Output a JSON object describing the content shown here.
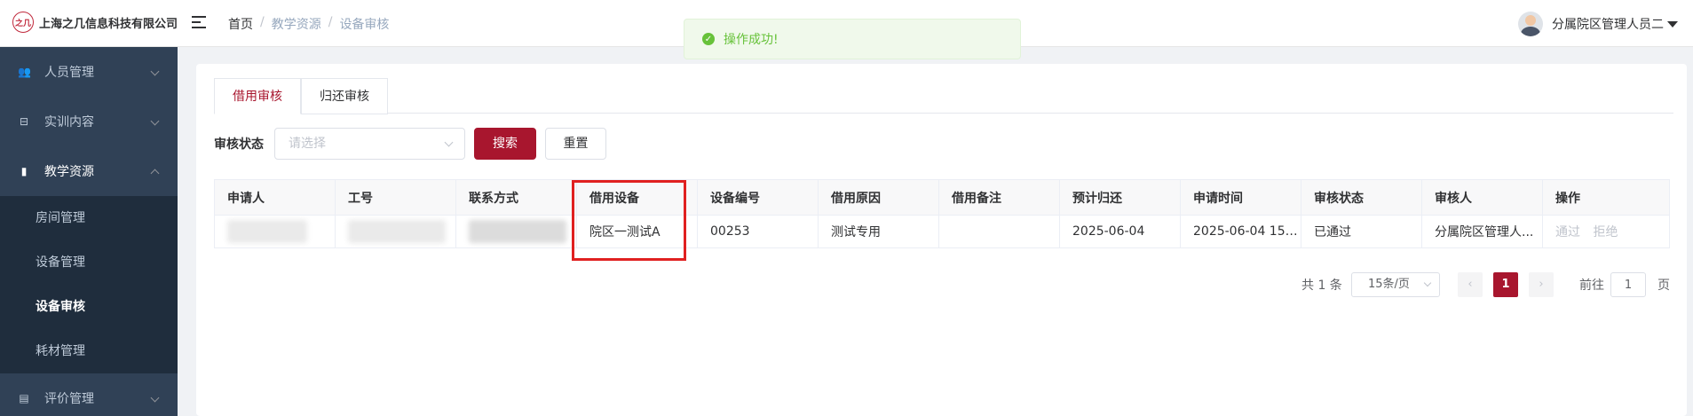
{
  "header": {
    "logo_mark": "之几",
    "company": "上海之几信息科技有限公司",
    "breadcrumb": [
      "首页",
      "教学资源",
      "设备审核"
    ],
    "user_name": "分属院区管理人员二"
  },
  "toast": {
    "message": "操作成功!"
  },
  "sidebar": {
    "menus": [
      {
        "label": "人员管理",
        "icon": "users-icon"
      },
      {
        "label": "实训内容",
        "icon": "training-icon"
      },
      {
        "label": "教学资源",
        "icon": "resource-icon"
      },
      {
        "label": "评价管理",
        "icon": "evaluation-icon"
      }
    ],
    "submenu": [
      "房间管理",
      "设备管理",
      "设备审核",
      "耗材管理"
    ]
  },
  "tabs": [
    "借用审核",
    "归还审核"
  ],
  "filter": {
    "label": "审核状态",
    "placeholder": "请选择",
    "search": "搜索",
    "reset": "重置"
  },
  "table": {
    "columns": [
      "申请人",
      "工号",
      "联系方式",
      "借用设备",
      "设备编号",
      "借用原因",
      "借用备注",
      "预计归还",
      "申请时间",
      "审核状态",
      "审核人",
      "操作"
    ],
    "rows": [
      {
        "device": "院区一测试A",
        "device_no": "00253",
        "reason": "测试专用",
        "remark": "",
        "return_date": "2025-06-04",
        "apply_time": "2025-06-04 15:...",
        "status": "已通过",
        "reviewer": "分属院区管理人...",
        "actions": [
          "通过",
          "拒绝"
        ]
      }
    ]
  },
  "pagination": {
    "total": "共 1 条",
    "page_size": "15条/页",
    "current": "1",
    "goto_label": "前往",
    "goto_value": "1",
    "page_unit": "页",
    "prev": "‹",
    "next": "›"
  },
  "colors": {
    "accent": "#a8162e",
    "sidebar": "#304156",
    "success": "#67c23a",
    "highlight": "#e02020"
  }
}
